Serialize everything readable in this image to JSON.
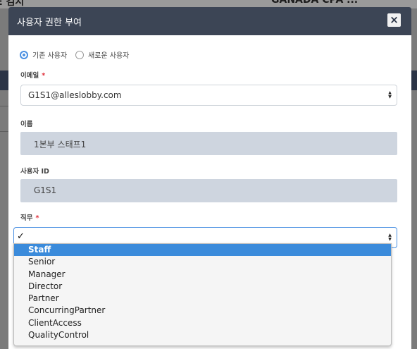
{
  "background": {
    "left_heading": "E 검시",
    "right_heading": "GANADA CPA ..."
  },
  "modal": {
    "title": "사용자 권한 부여",
    "close_label": "×"
  },
  "user_type": {
    "options": [
      {
        "label": "기존 사용자",
        "selected": true
      },
      {
        "label": "새로운 사용자",
        "selected": false
      }
    ]
  },
  "form": {
    "email": {
      "label": "이메일",
      "required_mark": "*",
      "value": "G1S1@alleslobby.com"
    },
    "name": {
      "label": "이름",
      "value": "1본부 스태프1"
    },
    "user_id": {
      "label": "사용자 ID",
      "value": "G1S1"
    },
    "role": {
      "label": "직무",
      "required_mark": "*",
      "current_mark": "✓",
      "options": [
        "Staff",
        "Senior",
        "Manager",
        "Director",
        "Partner",
        "ConcurringPartner",
        "ClientAccess",
        "QualityControl"
      ],
      "highlighted_index": 0
    }
  },
  "icons": {
    "select_arrows": "▲▼",
    "close": "close-icon"
  },
  "colors": {
    "header": "#3c4555",
    "radio_accent": "#4a90e2",
    "required": "#e0303c",
    "readonly_bg": "#ced5df",
    "dropdown_highlight": "#3b8bdb"
  }
}
